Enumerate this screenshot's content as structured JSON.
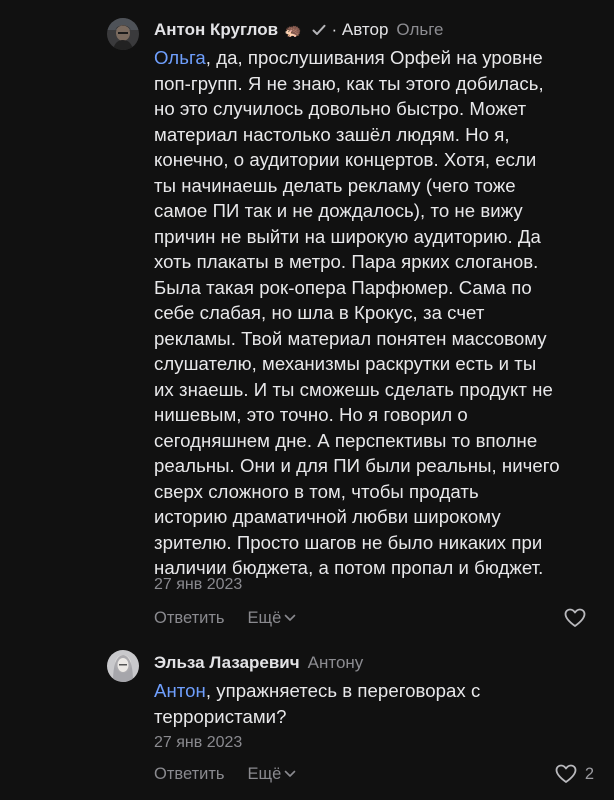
{
  "comments": [
    {
      "author": "Антон Круглов",
      "emoji": "🦔",
      "role": "· Автор",
      "reply_to": "Ольге",
      "mention": "Ольга",
      "text_lines": [
        ", да, прослушивания Орфей на уровне",
        "поп-групп. Я не знаю, как ты этого добилась,",
        "но это случилось довольно быстро. Может",
        "материал настолько зашёл людям. Но я,",
        "конечно, о аудитории концертов. Хотя, если",
        "ты начинаешь делать рекламу (чего тоже",
        "самое ПИ так и не дождалось), то не вижу",
        "причин не выйти на широкую аудиторию. Да",
        "хоть плакаты в метро. Пара ярких слоганов.",
        "Была такая рок-опера Парфюмер. Сама по",
        "себе слабая, но шла в Крокус, за счет",
        "рекламы. Твой материал понятен массовому",
        "слушателю, механизмы раскрутки есть и ты",
        "их знаешь. И ты сможешь сделать продукт не",
        "нишевым, это точно. Но я говорил о",
        "сегодняшнем дне. А перспективы то вполне",
        "реальны. Они и для ПИ были реальны, ничего",
        "сверх сложного в том, чтобы продать",
        "историю драматичной любви широкому",
        "зрителю. Просто шагов не было никаких при",
        "наличии бюджета, а потом пропал и бюджет."
      ],
      "date": "27 янв 2023",
      "reply_label": "Ответить",
      "more_label": "Ещё",
      "likes": ""
    },
    {
      "author": "Эльза Лазаревич",
      "reply_to": "Антону",
      "mention": "Антон",
      "text_lines": [
        ", упражняетесь в переговорах с",
        "террористами?"
      ],
      "date": "27 янв 2023",
      "reply_label": "Ответить",
      "more_label": "Ещё",
      "likes": "2"
    }
  ],
  "colors": {
    "background": "#111111",
    "text": "#e8e8ea",
    "muted": "#8a8a8f",
    "mention": "#6f9ffd"
  }
}
